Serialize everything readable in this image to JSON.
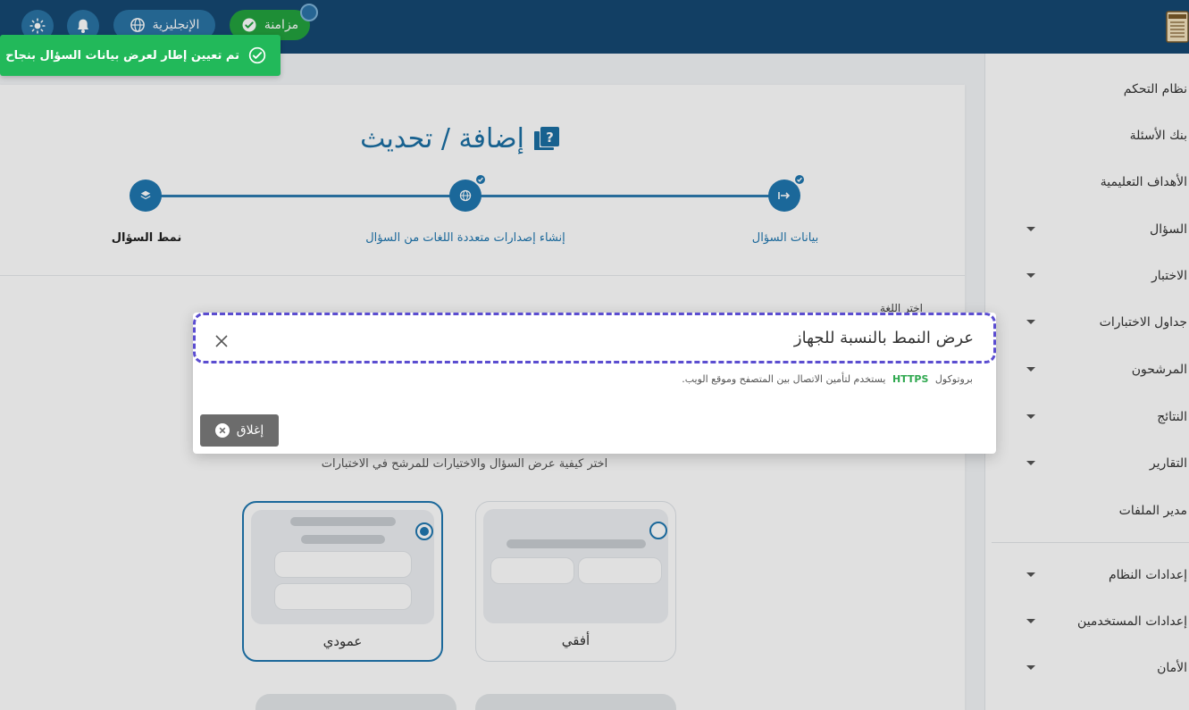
{
  "topbar": {
    "language_label": "الإنجليزية",
    "sync_label": "مزامنة"
  },
  "toast": {
    "message": "تم تعيين إطار لعرض بيانات السؤال بنجاح"
  },
  "page": {
    "title": "إضافة / تحديث"
  },
  "stepper": {
    "steps": [
      {
        "label": "بيانات السؤال"
      },
      {
        "label": "إنشاء إصدارات متعددة اللغات من السؤال"
      },
      {
        "label": "نمط السؤال"
      }
    ]
  },
  "form": {
    "language_label": "اختر اللغة",
    "choose_text": "اختر كيفية عرض السؤال والاختيارات للمرشح في الاختبارات",
    "layouts": [
      {
        "label": "أفقي",
        "selected": false
      },
      {
        "label": "عمودي",
        "selected": true
      }
    ]
  },
  "sidebar": {
    "items": [
      {
        "label": "نظام التحكم"
      },
      {
        "label": "بنك الأسئلة"
      },
      {
        "label": "الأهداف التعليمية"
      },
      {
        "label": "السؤال"
      },
      {
        "label": "الاختبار"
      },
      {
        "label": "جداول الاختبارات"
      },
      {
        "label": "المرشحون"
      },
      {
        "label": "النتائج"
      },
      {
        "label": "التقارير"
      },
      {
        "label": "مدير الملفات"
      },
      {
        "label": "إعدادات النظام"
      },
      {
        "label": "إعدادات المستخدمين"
      },
      {
        "label": "الأمان"
      }
    ]
  },
  "modal": {
    "title": "عرض النمط بالنسبة للجهاز",
    "body_prefix": "بروتوكول",
    "body_highlight": "HTTPS",
    "body_suffix": "يستخدم لتأمين الاتصال بين المتصفح وموقع الويب.",
    "close_button": "إغلاق"
  },
  "colors": {
    "topbar": "#154872",
    "primary": "#1f77b0",
    "success": "#22b95a",
    "focus_dash": "#5b4dd0"
  }
}
